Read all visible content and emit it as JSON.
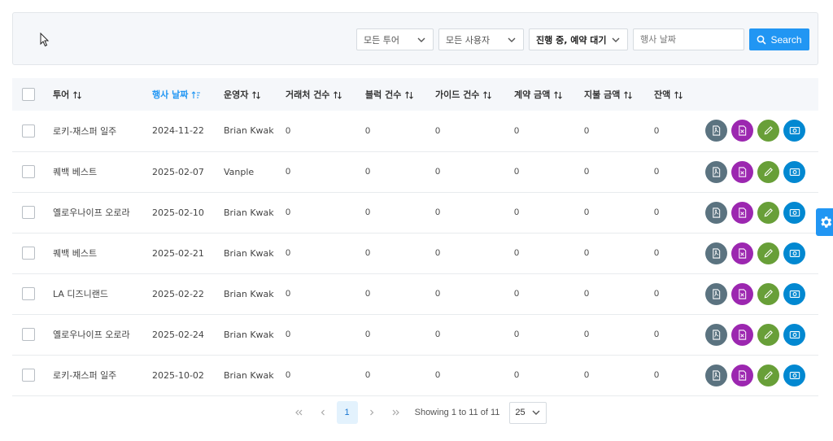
{
  "filters": {
    "tour": "모든 투어",
    "user": "모든 사용자",
    "status": "진행 중, 예약 대기",
    "date_placeholder": "행사 날짜",
    "search_label": "Search"
  },
  "table": {
    "headers": [
      "투어",
      "행사 날짜",
      "운영자",
      "거래처 건수",
      "블럭 건수",
      "가이드 건수",
      "계약 금액",
      "지불 금액",
      "잔액"
    ],
    "rows": [
      [
        "로키-재스퍼 일주",
        "2024-11-22",
        "Brian Kwak",
        "0",
        "0",
        "0",
        "0",
        "0",
        "0"
      ],
      [
        "퀘백 베스트",
        "2025-02-07",
        "Vanple",
        "0",
        "0",
        "0",
        "0",
        "0",
        "0"
      ],
      [
        "옐로우나이프 오로라",
        "2025-02-10",
        "Brian Kwak",
        "0",
        "0",
        "0",
        "0",
        "0",
        "0"
      ],
      [
        "퀘백 베스트",
        "2025-02-21",
        "Brian Kwak",
        "0",
        "0",
        "0",
        "0",
        "0",
        "0"
      ],
      [
        "LA 디즈니랜드",
        "2025-02-22",
        "Brian Kwak",
        "0",
        "0",
        "0",
        "0",
        "0",
        "0"
      ],
      [
        "옐로우나이프 오로라",
        "2025-02-24",
        "Brian Kwak",
        "0",
        "0",
        "0",
        "0",
        "0",
        "0"
      ],
      [
        "로키-재스퍼 일주",
        "2025-10-02",
        "Brian Kwak",
        "0",
        "0",
        "0",
        "0",
        "0",
        "0"
      ]
    ],
    "row_action_icons": [
      "pdf-icon",
      "document-icon",
      "edit-icon",
      "view-icon"
    ]
  },
  "pagination": {
    "current_page": "1",
    "info": "Showing 1 to 11 of 11",
    "page_size": "25"
  },
  "colors": {
    "accent": "#2196f3",
    "action_grey": "#5b7380",
    "action_purple": "#9c27b0",
    "action_green": "#689f38",
    "action_blue": "#0288d1"
  }
}
